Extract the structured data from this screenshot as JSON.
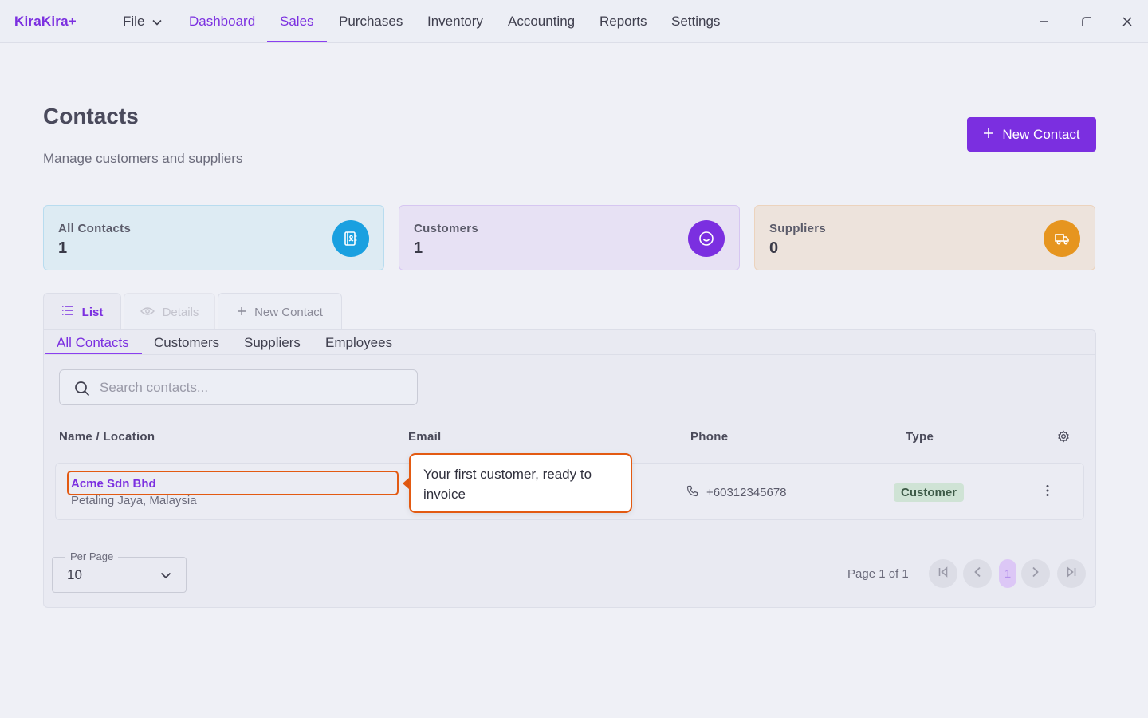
{
  "app": {
    "brand": "KiraKira+"
  },
  "nav": {
    "file": "File",
    "items": [
      "Dashboard",
      "Sales",
      "Purchases",
      "Inventory",
      "Accounting",
      "Reports",
      "Settings"
    ],
    "active": "Sales"
  },
  "header": {
    "title": "Contacts",
    "subtitle": "Manage customers and suppliers",
    "new_button": "New Contact"
  },
  "stats": [
    {
      "label": "All Contacts",
      "value": "1",
      "icon": "contact-book-icon",
      "color": "#1aa0e0"
    },
    {
      "label": "Customers",
      "value": "1",
      "icon": "smiley-icon",
      "color": "#7b2fe0"
    },
    {
      "label": "Suppliers",
      "value": "0",
      "icon": "truck-icon",
      "color": "#e6951f"
    }
  ],
  "view_tabs": {
    "list": "List",
    "details": "Details",
    "new": "New Contact"
  },
  "filter_tabs": [
    "All Contacts",
    "Customers",
    "Suppliers",
    "Employees"
  ],
  "search": {
    "placeholder": "Search contacts..."
  },
  "table": {
    "headers": {
      "name": "Name / Location",
      "email": "Email",
      "phone": "Phone",
      "type": "Type"
    },
    "rows": [
      {
        "name": "Acme Sdn Bhd",
        "location": "Petaling Jaya, Malaysia",
        "email": "",
        "phone": "+60312345678",
        "type": "Customer"
      }
    ]
  },
  "pagination": {
    "per_page_label": "Per Page",
    "per_page_value": "10",
    "page_info": "Page 1 of 1",
    "current_page": "1"
  },
  "tooltip": {
    "text": "Your first customer, ready to invoice"
  }
}
